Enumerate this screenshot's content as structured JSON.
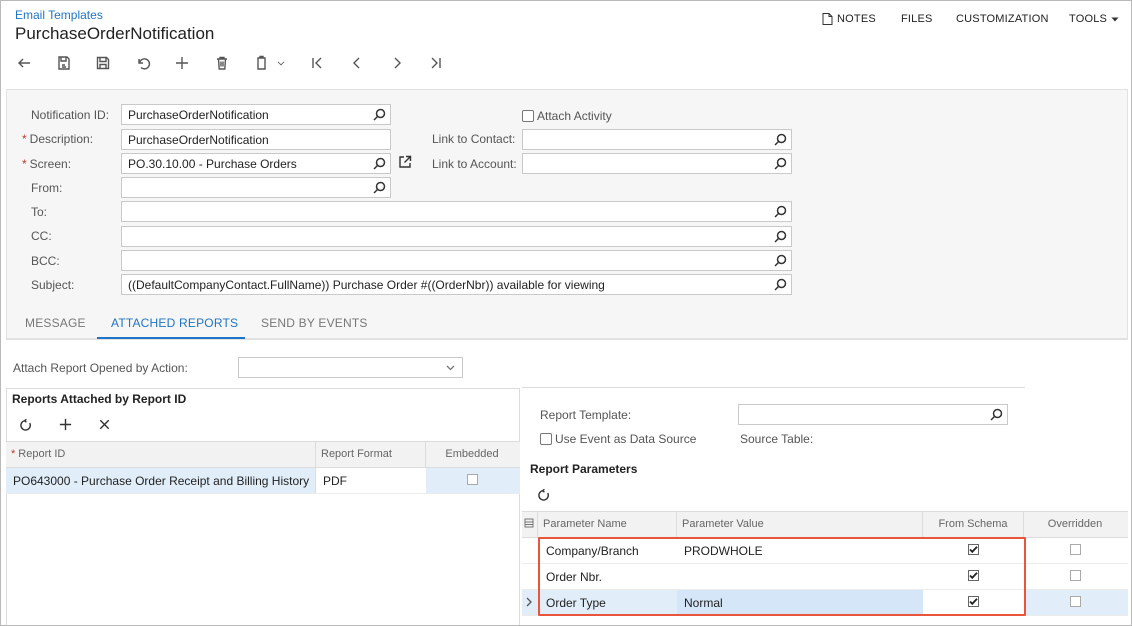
{
  "header": {
    "breadcrumb": "Email Templates",
    "title": "PurchaseOrderNotification",
    "menu": {
      "notes": "NOTES",
      "files": "FILES",
      "customization": "CUSTOMIZATION",
      "tools": "TOOLS"
    }
  },
  "toolbar": [
    "back-icon",
    "cancel-save-icon",
    "save-icon",
    "undo-icon",
    "add-icon",
    "delete-icon",
    "copy-paste-icon",
    "first-icon",
    "prev-icon",
    "next-icon",
    "last-icon"
  ],
  "form": {
    "notification_id": {
      "label": "Notification ID:",
      "value": "PurchaseOrderNotification"
    },
    "description": {
      "label": "Description:",
      "value": "PurchaseOrderNotification"
    },
    "screen": {
      "label": "Screen:",
      "value": "PO.30.10.00 - Purchase Orders"
    },
    "from": {
      "label": "From:",
      "value": ""
    },
    "to": {
      "label": "To:",
      "value": ""
    },
    "cc": {
      "label": "CC:",
      "value": ""
    },
    "bcc": {
      "label": "BCC:",
      "value": ""
    },
    "subject": {
      "label": "Subject:",
      "value": "((DefaultCompanyContact.FullName)) Purchase Order #((OrderNbr)) available for viewing"
    },
    "attach_activity": {
      "label": "Attach Activity",
      "checked": false
    },
    "link_contact": {
      "label": "Link to Contact:",
      "value": ""
    },
    "link_account": {
      "label": "Link to Account:",
      "value": ""
    }
  },
  "tabs": {
    "message": "MESSAGE",
    "attached_reports": "ATTACHED REPORTS",
    "send_by_events": "SEND BY EVENTS",
    "active": "attached_reports"
  },
  "attach_by_action": {
    "label": "Attach Report Opened by Action:",
    "value": ""
  },
  "reports_grid": {
    "title": "Reports Attached by Report ID",
    "columns": {
      "report_id": "Report ID",
      "report_format": "Report Format",
      "embedded": "Embedded"
    },
    "rows": [
      {
        "report_id": "PO643000 - Purchase Order Receipt and Billing History",
        "report_format": "PDF",
        "embedded": false
      }
    ]
  },
  "report_template": {
    "label": "Report Template:",
    "value": "",
    "use_event": {
      "label": "Use Event as Data Source",
      "checked": false
    },
    "source_table_label": "Source Table:"
  },
  "params_grid": {
    "title": "Report Parameters",
    "columns": {
      "name": "Parameter Name",
      "value": "Parameter Value",
      "from_schema": "From Schema",
      "overridden": "Overridden"
    },
    "rows": [
      {
        "name": "Company/Branch",
        "value": "PRODWHOLE",
        "from_schema": true,
        "overridden": false
      },
      {
        "name": "Order Nbr.",
        "value": "",
        "from_schema": true,
        "overridden": false
      },
      {
        "name": "Order Type",
        "value": "Normal",
        "from_schema": true,
        "overridden": false
      }
    ]
  },
  "colors": {
    "accent": "#1f74c5",
    "highlight": "#e8553a",
    "selected_row": "#e1eefa"
  }
}
